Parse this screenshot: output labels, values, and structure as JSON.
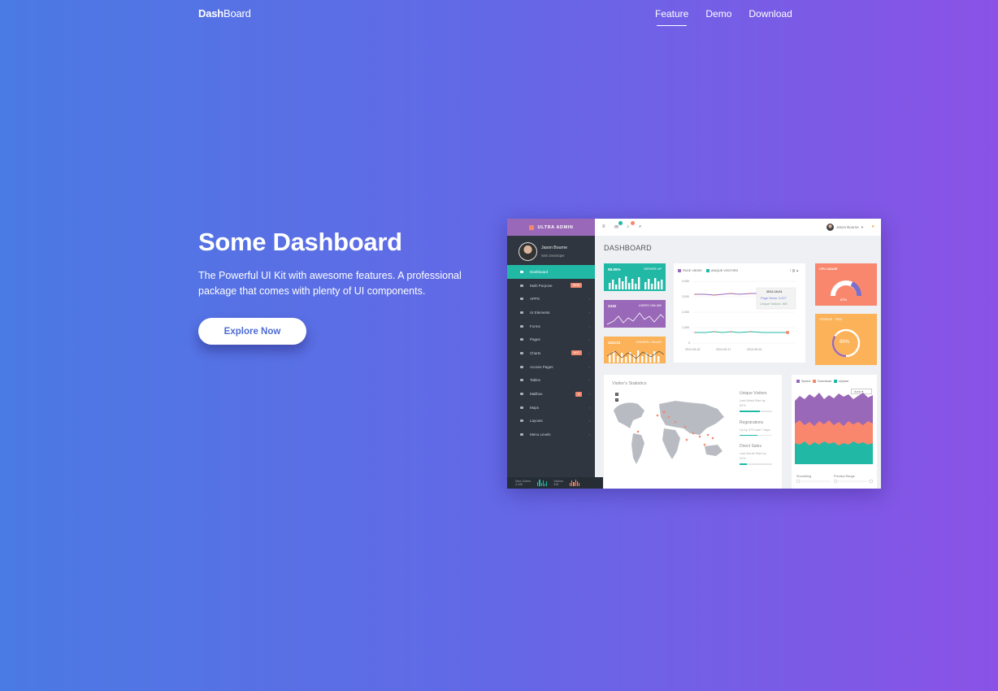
{
  "nav": {
    "brand_bold": "Dash",
    "brand_rest": "Board",
    "links": [
      {
        "label": "Feature",
        "active": true
      },
      {
        "label": "Demo",
        "active": false
      },
      {
        "label": "Download",
        "active": false
      }
    ]
  },
  "hero": {
    "title": "Some Dashboard",
    "description": "The Powerful UI Kit with awesome features. A professional package that comes with plenty of UI components.",
    "cta_label": "Explore Now"
  },
  "mockup": {
    "logo": "ULTRA ADMIN",
    "profile_name": "Jason Bourne",
    "profile_role": "Web Developer",
    "menu": [
      {
        "label": "Dashboard",
        "active": true,
        "chevron": false
      },
      {
        "label": "Multi Purpose",
        "badge": "NEW",
        "badge_color": "#ef8a6f",
        "chevron": false
      },
      {
        "label": "APPS",
        "chevron": true
      },
      {
        "label": "UI Elements",
        "chevron": true
      },
      {
        "label": "Forms",
        "chevron": true
      },
      {
        "label": "Pages",
        "chevron": true
      },
      {
        "label": "Charts",
        "badge": "HOT",
        "badge_color": "#ef8a6f",
        "chevron": true
      },
      {
        "label": "Access Pages",
        "chevron": true
      },
      {
        "label": "Tables",
        "chevron": true
      },
      {
        "label": "Mailbox",
        "badge": "4",
        "badge_color": "#ef8a6f",
        "chevron": true
      },
      {
        "label": "Maps",
        "chevron": true
      },
      {
        "label": "Layouts",
        "chevron": true
      },
      {
        "label": "Menu Levels",
        "chevron": true
      }
    ],
    "footer": {
      "new_orders_label": "New Orders",
      "new_orders_value": "2,345",
      "visitors_label": "Visitors",
      "visitors_value": "345"
    },
    "topbar_user": "Jason Bourne",
    "page_title": "DASHBOARD",
    "stats": [
      {
        "value": "98.95%",
        "label": "SERVER UP",
        "color": "#21b8a6"
      },
      {
        "value": "2332",
        "label": "USERS ONLINE",
        "color": "#9a68b8"
      },
      {
        "value": "342123",
        "label": "ORDERS / SALES",
        "color": "#fbb258"
      }
    ],
    "line_chart": {
      "legend": [
        "PAGE VIEWS",
        "UNIQUE VISITORS"
      ],
      "legend_colors": [
        "#9a68b8",
        "#21b8a6"
      ],
      "y_ticks": [
        "4,000",
        "3,000",
        "2,000",
        "1,000",
        "0"
      ],
      "x_ticks": [
        "2012-09-15",
        "2012-09-17",
        "2012-09-24"
      ],
      "tooltip_date": "2012-10-01",
      "tooltip_views": "Page Views: 3,407",
      "tooltip_unique": "Unique Visitors: 660"
    },
    "cpu": {
      "label": "CPU USAGE",
      "value": "67%",
      "color": "#f8876d"
    },
    "vendor": {
      "label": "VENDOR",
      "sublabel": "PAID",
      "value": "66%",
      "color": "#fbb258"
    },
    "visitors": {
      "title": "Visitor's Statistics",
      "items": [
        {
          "title": "Unique Visitors",
          "sub": "Last Week Rise by",
          "pct": "62%",
          "fill": 0.62
        },
        {
          "title": "Registrations",
          "sub": "Up by 37% last 7 days",
          "pct": "",
          "fill": 0.55
        },
        {
          "title": "Direct Sales",
          "sub": "Last Month Rise by",
          "pct": "22%",
          "fill": 0.22
        }
      ]
    },
    "area_chart": {
      "legend": [
        "Speed",
        "Download",
        "Upload"
      ],
      "legend_colors": [
        "#9a68b8",
        "#f8876d",
        "#21b8a6"
      ],
      "select_value": "Area",
      "smoothing_label": "Smoothing",
      "preview_label": "Preview Range"
    }
  }
}
